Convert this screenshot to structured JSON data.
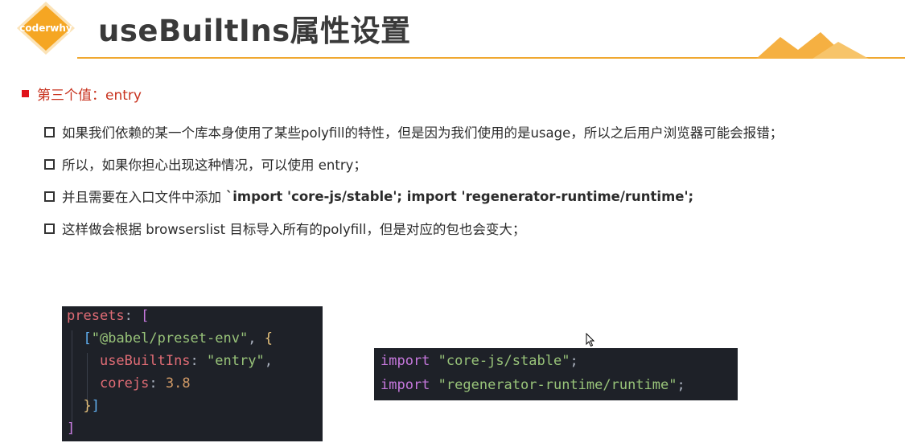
{
  "logo": {
    "text": "coderwhy",
    "color": "#f5a623"
  },
  "title": "useBuiltIns属性设置",
  "accent_color": "#f0a830",
  "section": {
    "heading": "第三个值：entry",
    "heading_color": "#c8321e",
    "bullets": [
      {
        "text": "如果我们依赖的某一个库本身使用了某些polyfill的特性，但是因为我们使用的是usage，所以之后用户浏览器可能会报错；"
      },
      {
        "text": "所以，如果你担心出现这种情况，可以使用 entry；"
      },
      {
        "text": "并且需要在入口文件中添加",
        "code": "`import 'core-js/stable'; import 'regenerator-runtime/runtime';"
      },
      {
        "text": "这样做会根据 browserslist 目标导入所有的polyfill，但是对应的包也会变大；"
      }
    ]
  },
  "code_block_1": {
    "l1_key": "presets",
    "l1_colon": ":",
    "l1_open": " [",
    "l2_open": "[",
    "l2_str": "\"@babel/preset-env\"",
    "l2_comma": ",",
    "l2_brace": " {",
    "l3_key": "useBuiltIns",
    "l3_colon": ": ",
    "l3_val": "\"entry\"",
    "l3_comma": ",",
    "l4_key": "corejs",
    "l4_colon": ": ",
    "l4_val": "3.8",
    "l5_brace": "}",
    "l5_brk": "]",
    "l6_brk": "]"
  },
  "code_block_2": {
    "l1_kw": "import",
    "l1_str": "\"core-js/stable\"",
    "l1_end": ";",
    "l2_kw": "import",
    "l2_str": "\"regenerator-runtime/runtime\"",
    "l2_end": ";"
  }
}
